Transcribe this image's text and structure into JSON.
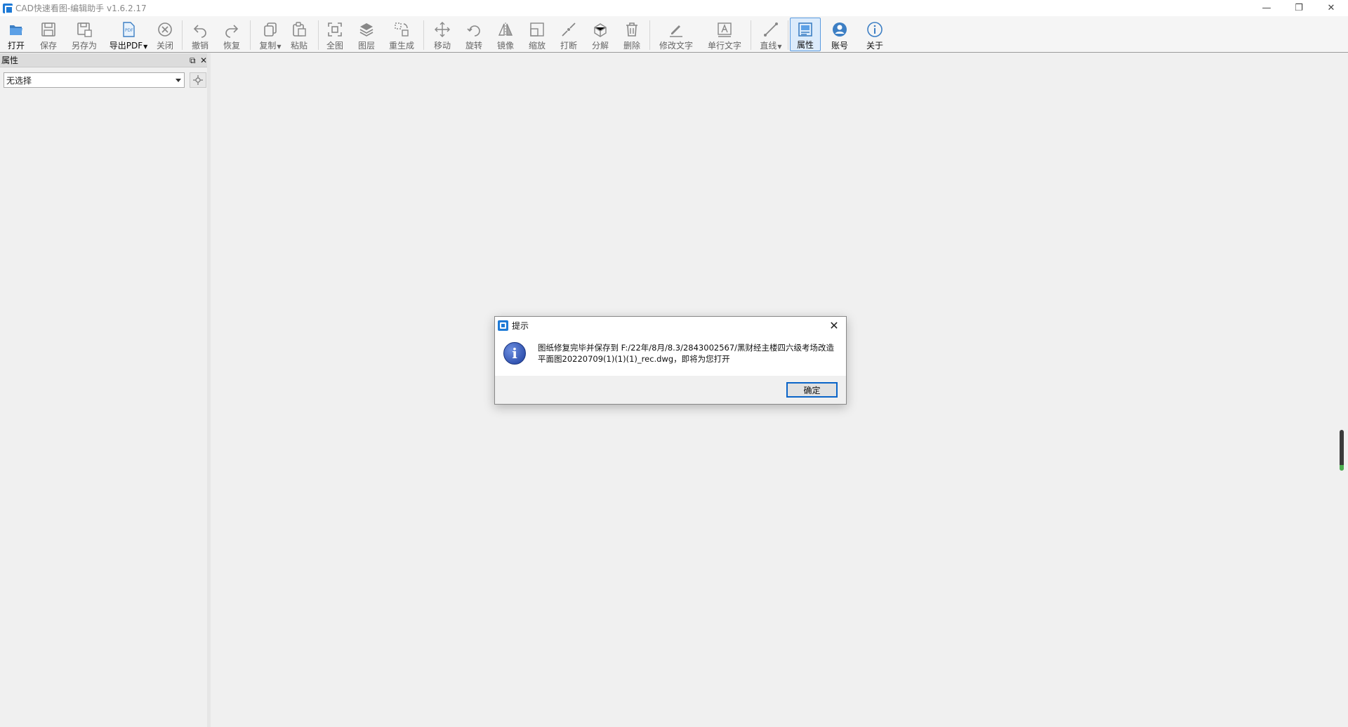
{
  "window": {
    "title": "CAD快速看图-编辑助手 v1.6.2.17"
  },
  "toolbar": {
    "open": "打开",
    "save": "保存",
    "save_as": "另存为",
    "export_pdf": "导出PDF",
    "close": "关闭",
    "undo": "撤销",
    "redo": "恢复",
    "copy": "复制",
    "paste": "粘贴",
    "zoom_all": "全图",
    "layers": "图层",
    "regen": "重生成",
    "move": "移动",
    "rotate": "旋转",
    "mirror": "镜像",
    "scale": "缩放",
    "break": "打断",
    "explode": "分解",
    "delete": "删除",
    "edit_text": "修改文字",
    "single_text": "单行文字",
    "line": "直线",
    "properties": "属性",
    "account": "账号",
    "about": "关于"
  },
  "panel": {
    "title": "属性",
    "selection_value": "无选择"
  },
  "dialog": {
    "title": "提示",
    "message": "图纸修复完毕并保存到 F:/22年/8月/8.3/2843002567/黑财经主楼四六级考场改造平面图20220709(1)(1)(1)_rec.dwg，即将为您打开",
    "ok": "确定"
  },
  "colors": {
    "accent": "#1e7ad6",
    "active_bg": "#dcebfb",
    "active_border": "#5a9be0"
  }
}
